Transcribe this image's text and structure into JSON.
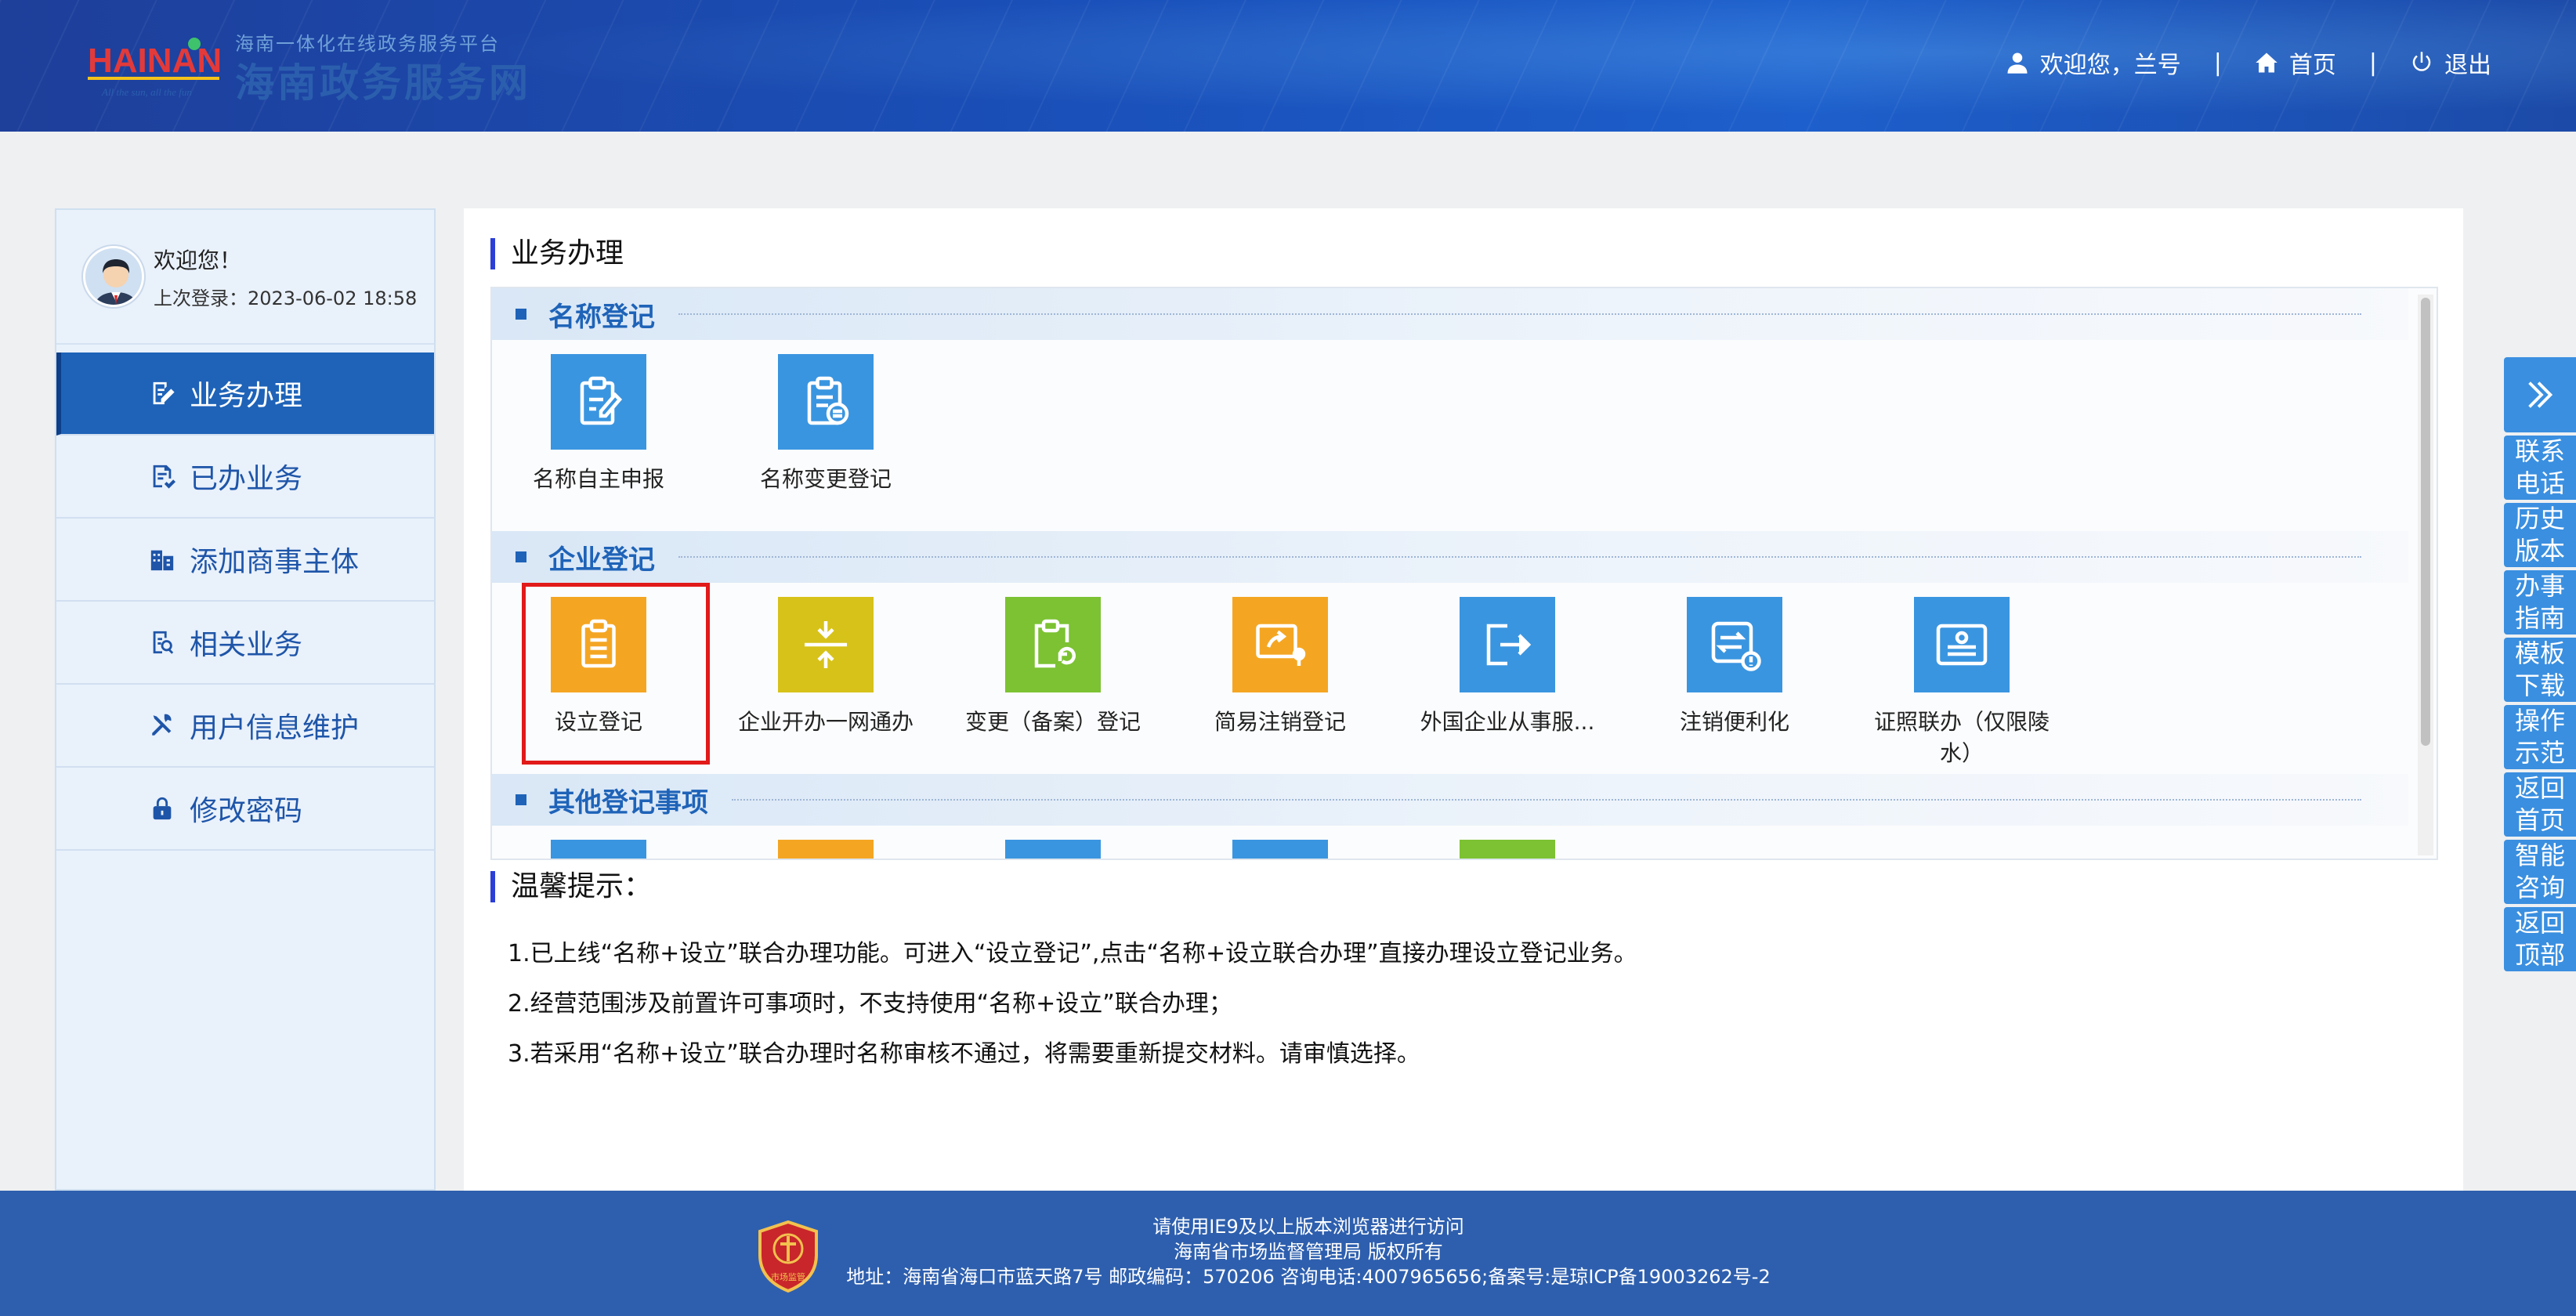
{
  "header": {
    "logo_brand": "HAINAN",
    "logo_slogan": "All the sun, all the fun",
    "site_title": "海南政务服务网",
    "site_subtitle": "海南一体化在线政务服务平台",
    "welcome": "欢迎您，兰号",
    "home": "首页",
    "logout": "退出"
  },
  "sidebar": {
    "greeting": "欢迎您！",
    "last_login": "上次登录：2023-06-02 18:58",
    "items": [
      {
        "label": "业务办理",
        "icon": "edit-doc-icon",
        "active": true
      },
      {
        "label": "已办业务",
        "icon": "check-doc-icon",
        "active": false
      },
      {
        "label": "添加商事主体",
        "icon": "building-icon",
        "active": false
      },
      {
        "label": "相关业务",
        "icon": "search-doc-icon",
        "active": false
      },
      {
        "label": "用户信息维护",
        "icon": "tools-icon",
        "active": false
      },
      {
        "label": "修改密码",
        "icon": "lock-icon",
        "active": false
      }
    ]
  },
  "main": {
    "title": "业务办理",
    "categories": [
      {
        "name": "名称登记",
        "tiles": [
          {
            "label": "名称自主申报",
            "color": "#3a95e0",
            "icon": "clipboard-pen-icon"
          },
          {
            "label": "名称变更登记",
            "color": "#3a95e0",
            "icon": "clipboard-list-icon"
          }
        ]
      },
      {
        "name": "企业登记",
        "tiles": [
          {
            "label": "设立登记",
            "color": "#f4a623",
            "icon": "clipboard-icon"
          },
          {
            "label": "企业开办一网通办",
            "color": "#d7c21a",
            "icon": "compress-icon"
          },
          {
            "label": "变更（备案）登记",
            "color": "#7cc233",
            "icon": "clipboard-refresh-icon"
          },
          {
            "label": "简易注销登记",
            "color": "#f4a623",
            "icon": "share-screen-icon"
          },
          {
            "label": "外国企业从事服...",
            "color": "#3a95e0",
            "icon": "exit-arrow-icon"
          },
          {
            "label": "注销便利化",
            "color": "#3a95e0",
            "icon": "swap-info-icon"
          },
          {
            "label": "证照联办（仅限陵水）",
            "color": "#3a95e0",
            "icon": "id-card-icon"
          }
        ]
      },
      {
        "name": "其他登记事项",
        "tiles": [
          {
            "color": "#3a95e0"
          },
          {
            "color": "#f4a623"
          },
          {
            "color": "#3a95e0"
          },
          {
            "color": "#3a95e0"
          },
          {
            "color": "#7cc233"
          }
        ]
      }
    ],
    "tips_title": "温馨提示：",
    "tips": [
      "1.已上线“名称+设立”联合办理功能。可进入“设立登记”,点击“名称+设立联合办理”直接办理设立登记业务。",
      "2.经营范围涉及前置许可事项时，不支持使用“名称+设立”联合办理；",
      "3.若采用“名称+设立”联合办理时名称审核不通过，将需要重新提交材料。请审慎选择。"
    ]
  },
  "float_bar": {
    "items": [
      "联系\n电话",
      "历史\n版本",
      "办事\n指南",
      "模板\n下载",
      "操作\n示范",
      "返回\n首页",
      "智能\n咨询",
      "返回\n顶部"
    ]
  },
  "footer": {
    "line1": "请使用IE9及以上版本浏览器进行访问",
    "line2": "海南省市场监督管理局 版权所有",
    "line3": "地址：海南省海口市蓝天路7号 邮政编码：570206 咨询电话:4007965656;备案号:是琼ICP备19003262号-2",
    "emblem_text": "市场监管"
  }
}
